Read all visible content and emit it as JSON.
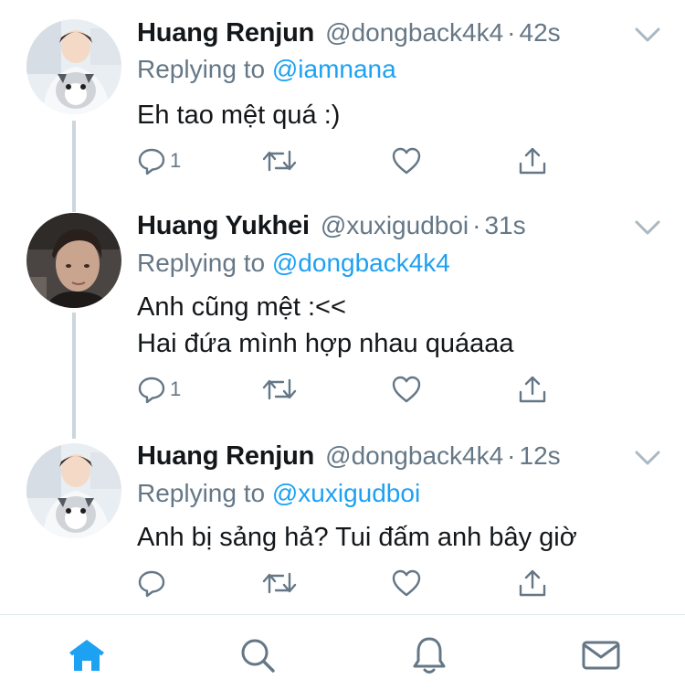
{
  "tweets": [
    {
      "name": "Huang Renjun",
      "handle": "@dongback4k4",
      "separator": "·",
      "time": "42s",
      "replying_prefix": "Replying to",
      "replying_to": "@iamnana",
      "lines": [
        "Eh tao mệt quá :)"
      ],
      "reply_count": "1",
      "avatar": "renjun-avatar"
    },
    {
      "name": "Huang Yukhei",
      "handle": "@xuxigudboi",
      "separator": "·",
      "time": "31s",
      "replying_prefix": "Replying to",
      "replying_to": "@dongback4k4",
      "lines": [
        "Anh cũng mệt :<<",
        "Hai đứa mình hợp nhau quáaaa"
      ],
      "reply_count": "1",
      "avatar": "yukhei-avatar"
    },
    {
      "name": "Huang Renjun",
      "handle": "@dongback4k4",
      "separator": "·",
      "time": "12s",
      "replying_prefix": "Replying to",
      "replying_to": "@xuxigudboi",
      "lines": [
        "Anh bị sảng hả? Tui đấm anh bây giờ"
      ],
      "reply_count": "",
      "avatar": "renjun-avatar"
    }
  ],
  "tabbar": {
    "items": [
      "home-icon",
      "search-icon",
      "notifications-icon",
      "messages-icon"
    ],
    "active": "home-icon"
  },
  "colors": {
    "accent": "#1da1f2",
    "muted": "#657786",
    "text": "#14171a",
    "thread_line": "#ccd6dd"
  }
}
